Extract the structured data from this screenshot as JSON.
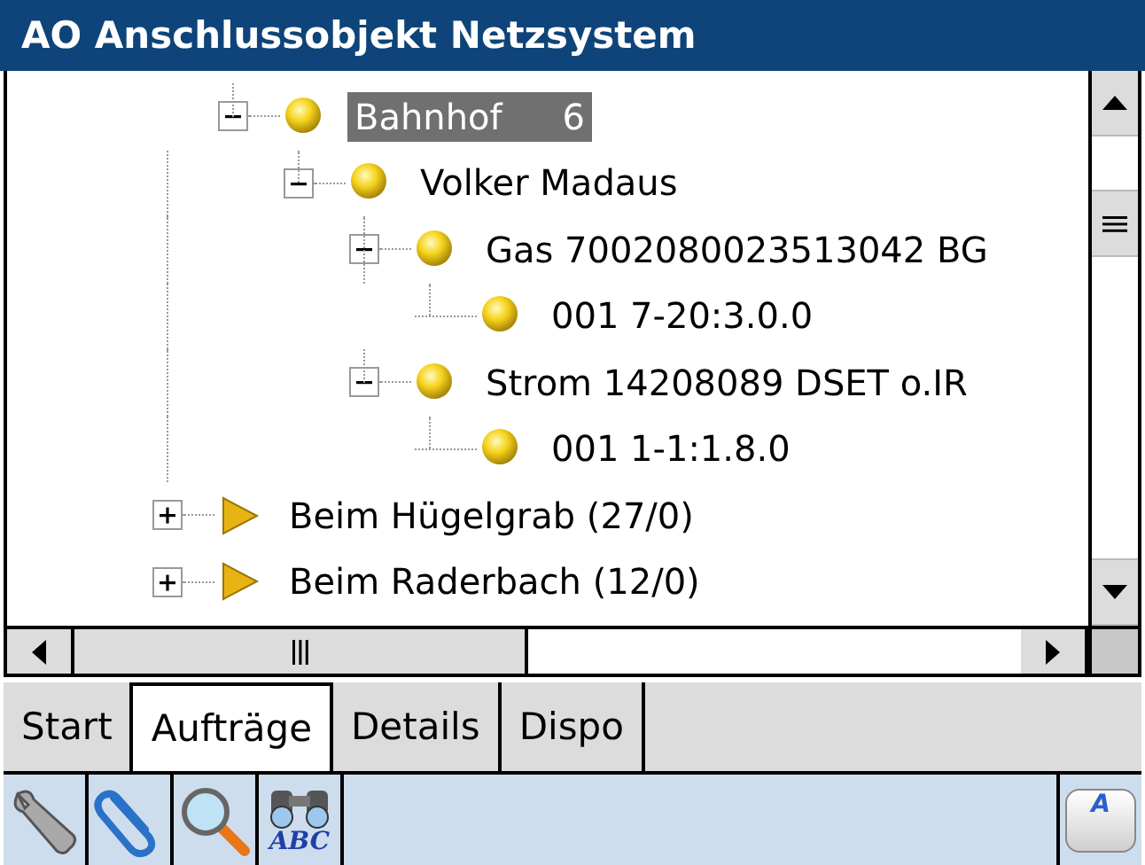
{
  "window": {
    "title": "AO Anschlussobjekt Netzsystem"
  },
  "tree": {
    "nodes": [
      {
        "kind": "offscreen",
        "children": [
          {
            "kind": "dot",
            "label": "Bahnhof",
            "count": "6",
            "selected": true,
            "expanded": true,
            "children": [
              {
                "kind": "dot",
                "label": "Volker Madaus",
                "selected": false,
                "expanded": true,
                "children": [
                  {
                    "kind": "dot",
                    "label": "Gas 7002080023513042 BG",
                    "selected": false,
                    "expanded": true,
                    "children": [
                      {
                        "kind": "dot",
                        "label": "001 7-20:3.0.0",
                        "selected": false
                      }
                    ]
                  },
                  {
                    "kind": "dot",
                    "label": "Strom 14208089 DSET o.IR",
                    "selected": false,
                    "expanded": true,
                    "children": [
                      {
                        "kind": "dot",
                        "label": "001 1-1:1.8.0",
                        "selected": false
                      }
                    ]
                  }
                ]
              }
            ]
          }
        ]
      },
      {
        "kind": "arrow",
        "label": "Beim Hügelgrab (27/0)",
        "selected": false,
        "expanded": false
      },
      {
        "kind": "arrow",
        "label": "Beim Raderbach (12/0)",
        "selected": false,
        "expanded": false
      }
    ]
  },
  "tabs": [
    {
      "label": "Start",
      "selected": false
    },
    {
      "label": "Aufträge",
      "selected": true
    },
    {
      "label": "Details",
      "selected": false
    },
    {
      "label": "Dispo",
      "selected": false
    }
  ],
  "toolbar": [
    {
      "kind": "wrench"
    },
    {
      "kind": "paperclip"
    },
    {
      "kind": "magnifier"
    },
    {
      "kind": "binoculars",
      "label": "ABC"
    }
  ],
  "keyboard_button": {
    "label": "A"
  }
}
